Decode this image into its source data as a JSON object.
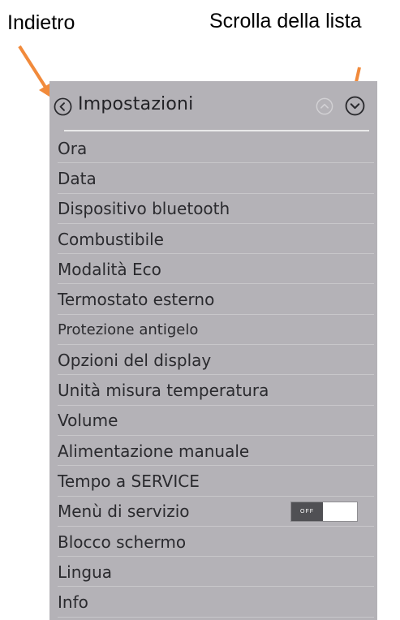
{
  "callouts": {
    "back": "Indietro",
    "scroll": "Scrolla della lista"
  },
  "colors": {
    "arrow": "#f18a3b",
    "panel_bg": "#b4b2b7",
    "text": "#2a2a2e"
  },
  "header": {
    "title": "Impostazioni",
    "back_icon": "chevron-left-circle-icon",
    "scroll_up_icon": "chevron-up-circle-icon",
    "scroll_down_icon": "chevron-down-circle-icon"
  },
  "menu": {
    "items": [
      {
        "label": "Ora"
      },
      {
        "label": "Data"
      },
      {
        "label": "Dispositivo bluetooth"
      },
      {
        "label": "Combustibile"
      },
      {
        "label": "Modalità Eco"
      },
      {
        "label": "Termostato esterno"
      },
      {
        "label": "Protezione antigelo"
      },
      {
        "label": "Opzioni del display"
      },
      {
        "label": "Unità misura temperatura"
      },
      {
        "label": "Volume"
      },
      {
        "label": "Alimentazione manuale"
      },
      {
        "label": "Tempo a SERVICE"
      },
      {
        "label": "Menù di servizio",
        "toggle": "OFF"
      },
      {
        "label": "Blocco schermo"
      },
      {
        "label": "Lingua"
      },
      {
        "label": "Info"
      }
    ]
  }
}
